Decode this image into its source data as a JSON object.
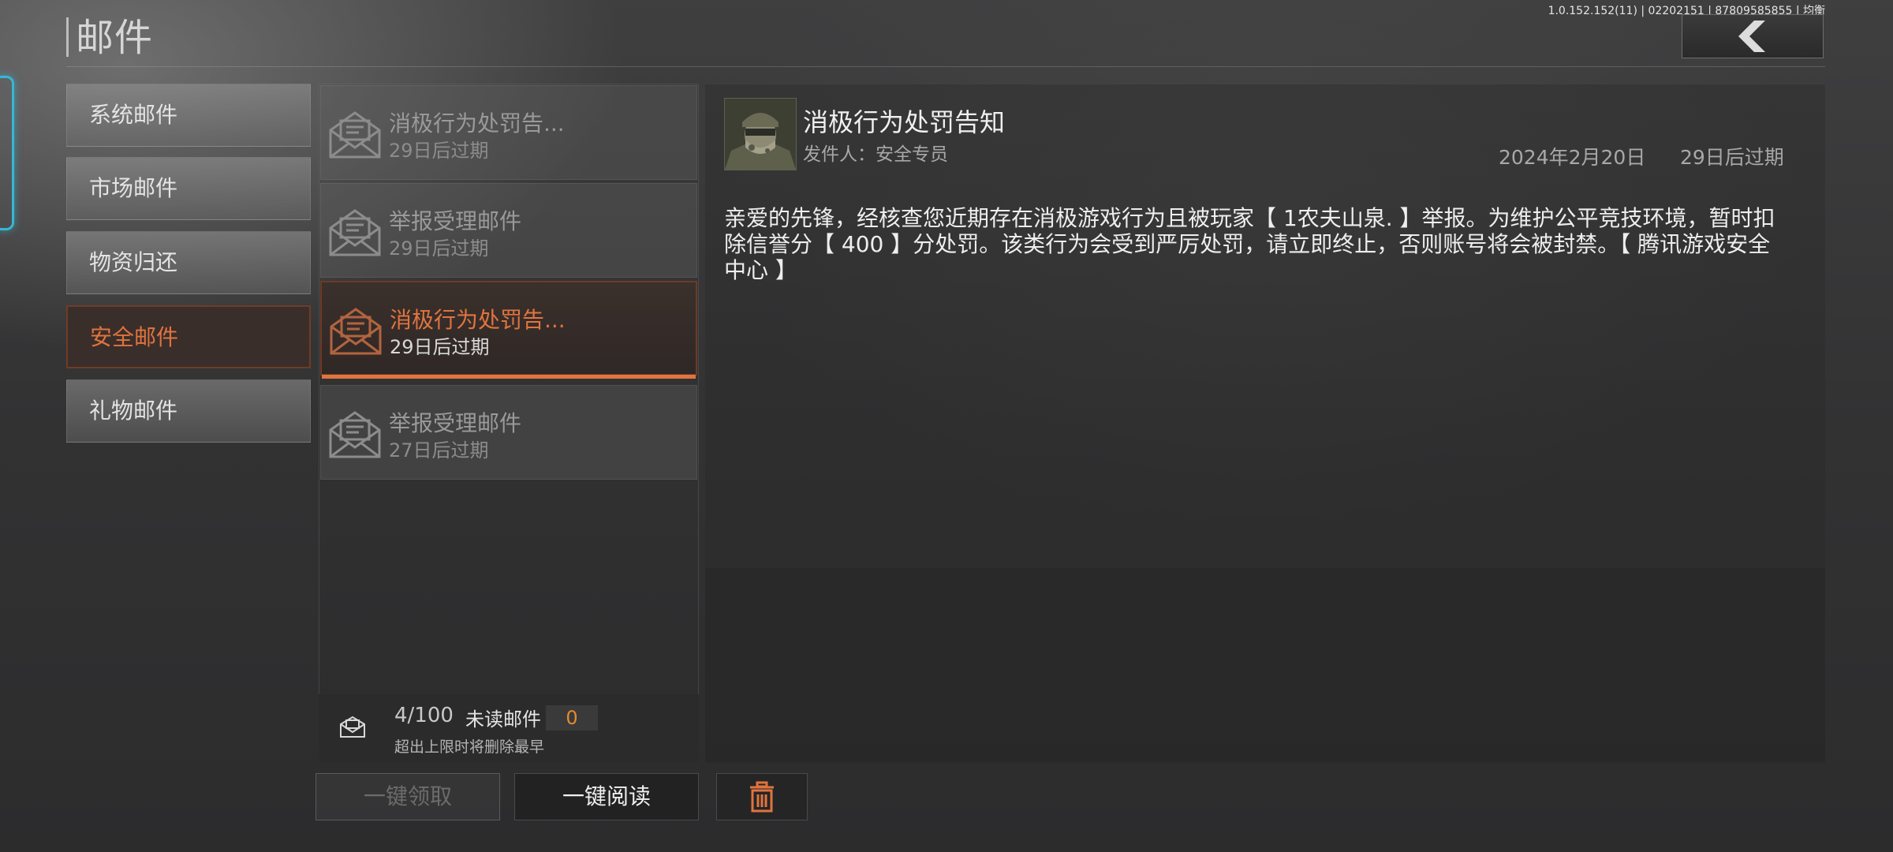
{
  "header": {
    "title": "邮件",
    "version": "1.0.152.152(11) | 02202151 | 87809585855 | 均衡",
    "back_icon": "chevron-left-icon"
  },
  "categories": [
    {
      "label": "系统邮件",
      "active": false
    },
    {
      "label": "市场邮件",
      "active": false
    },
    {
      "label": "物资归还",
      "active": false
    },
    {
      "label": "安全邮件",
      "active": true
    },
    {
      "label": "礼物邮件",
      "active": false
    }
  ],
  "mails": [
    {
      "subject": "消极行为处罚告...",
      "expiry": "29日后过期",
      "active": false,
      "icon": "envelope-open-icon"
    },
    {
      "subject": "举报受理邮件",
      "expiry": "29日后过期",
      "active": false,
      "icon": "envelope-open-icon"
    },
    {
      "subject": "消极行为处罚告...",
      "expiry": "29日后过期",
      "active": true,
      "icon": "envelope-open-icon"
    },
    {
      "subject": "举报受理邮件",
      "expiry": "27日后过期",
      "active": false,
      "icon": "envelope-open-icon"
    }
  ],
  "capacity": {
    "count": "4/100",
    "unread_label": "未读邮件",
    "unread_count": "0",
    "note": "超出上限时将删除最早"
  },
  "buttons": {
    "claim_all": "一键领取",
    "read_all": "一键阅读",
    "delete_icon": "trash-icon"
  },
  "detail": {
    "title": "消极行为处罚告知",
    "sender": "发件人：安全专员",
    "date": "2024年2月20日",
    "expiry": "29日后过期",
    "body": "亲爱的先锋，经核查您近期存在消极游戏行为且被玩家【 1农夫山泉. 】举报。为维护公平竞技环境，暂时扣除信誉分【 400 】分处罚。该类行为会受到严厉处罚，请立即终止，否则账号将会被封禁。【 腾讯游戏安全中心 】"
  },
  "colors": {
    "accent": "#e0743f",
    "unread_count": "#e58a2d",
    "glow": "#35b7d6"
  }
}
